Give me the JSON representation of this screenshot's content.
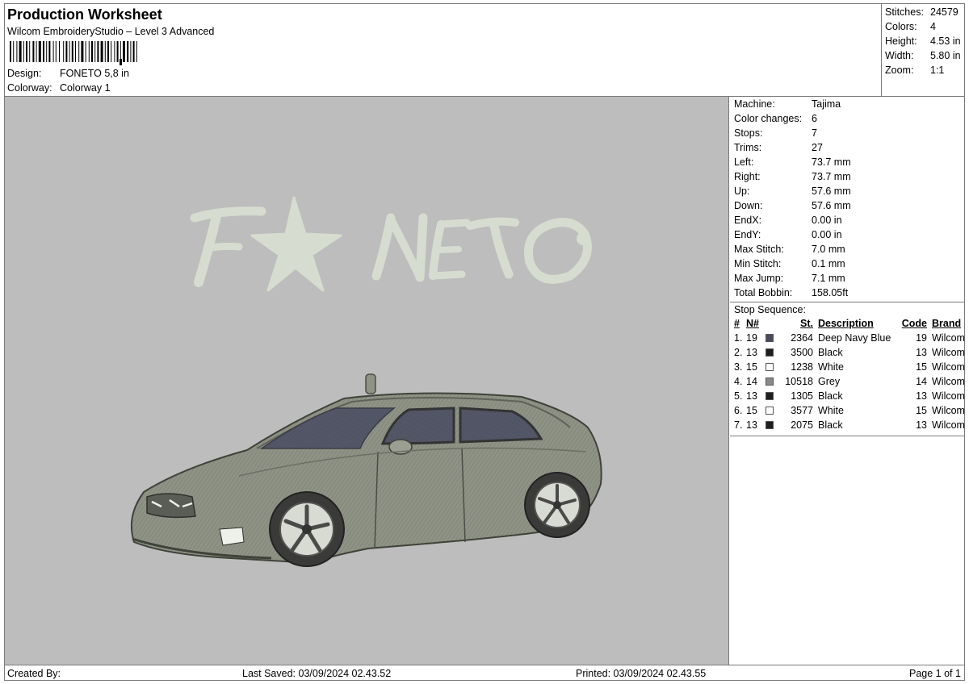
{
  "header": {
    "title": "Production Worksheet",
    "subtitle": "Wilcom EmbroideryStudio – Level 3 Advanced",
    "design_label": "Design:",
    "design_value": "FONETO 5,8 in",
    "colorway_label": "Colorway:",
    "colorway_value": "Colorway 1"
  },
  "summary": [
    {
      "label": "Stitches:",
      "value": "24579"
    },
    {
      "label": "Colors:",
      "value": "4"
    },
    {
      "label": "Height:",
      "value": "4.53 in"
    },
    {
      "label": "Width:",
      "value": "5.80 in"
    },
    {
      "label": "Zoom:",
      "value": "1:1"
    }
  ],
  "machine": [
    {
      "label": "Machine:",
      "value": "Tajima"
    },
    {
      "label": "Color changes:",
      "value": "6"
    },
    {
      "label": "Stops:",
      "value": "7"
    },
    {
      "label": "Trims:",
      "value": "27"
    },
    {
      "label": "Left:",
      "value": "73.7 mm"
    },
    {
      "label": "Right:",
      "value": "73.7 mm"
    },
    {
      "label": "Up:",
      "value": "57.6 mm"
    },
    {
      "label": "Down:",
      "value": "57.6 mm"
    },
    {
      "label": "EndX:",
      "value": "0.00 in"
    },
    {
      "label": "EndY:",
      "value": "0.00 in"
    },
    {
      "label": "Max Stitch:",
      "value": "7.0 mm"
    },
    {
      "label": "Min Stitch:",
      "value": "0.1 mm"
    },
    {
      "label": "Max Jump:",
      "value": "7.1 mm"
    },
    {
      "label": "Total Bobbin:",
      "value": "158.05ft"
    }
  ],
  "stop_sequence": {
    "title": "Stop Sequence:",
    "columns": {
      "num": "#",
      "n": "N#",
      "st": "St.",
      "desc": "Description",
      "code": "Code",
      "brand": "Brand"
    },
    "rows": [
      {
        "num": "1.",
        "n": "19",
        "color": "#4a4c5c",
        "st": "2364",
        "desc": "Deep Navy Blue",
        "code": "19",
        "brand": "Wilcom"
      },
      {
        "num": "2.",
        "n": "13",
        "color": "#1e1e1e",
        "st": "3500",
        "desc": "Black",
        "code": "13",
        "brand": "Wilcom"
      },
      {
        "num": "3.",
        "n": "15",
        "color": "#ffffff",
        "st": "1238",
        "desc": "White",
        "code": "15",
        "brand": "Wilcom"
      },
      {
        "num": "4.",
        "n": "14",
        "color": "#8a8a8a",
        "st": "10518",
        "desc": "Grey",
        "code": "14",
        "brand": "Wilcom"
      },
      {
        "num": "5.",
        "n": "13",
        "color": "#1e1e1e",
        "st": "1305",
        "desc": "Black",
        "code": "13",
        "brand": "Wilcom"
      },
      {
        "num": "6.",
        "n": "15",
        "color": "#ffffff",
        "st": "3577",
        "desc": "White",
        "code": "15",
        "brand": "Wilcom"
      },
      {
        "num": "7.",
        "n": "13",
        "color": "#1e1e1e",
        "st": "2075",
        "desc": "Black",
        "code": "13",
        "brand": "Wilcom"
      }
    ]
  },
  "preview": {
    "text": "FONETO",
    "background": "#bdbdbd",
    "text_color": "#d9dfd2",
    "car_body_color": "#8b9083",
    "window_color": "#4e505e"
  },
  "footer": {
    "created_by": "Created By:",
    "last_saved": "Last Saved: 03/09/2024 02.43.52",
    "printed": "Printed: 03/09/2024 02.43.55",
    "page": "Page 1 of 1"
  }
}
